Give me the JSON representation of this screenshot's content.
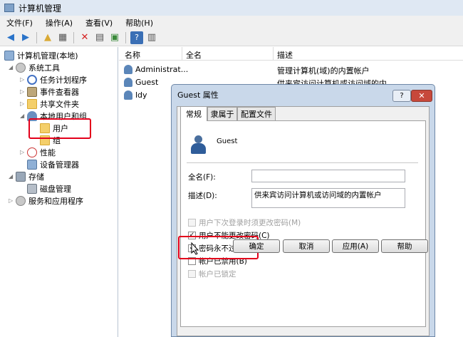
{
  "window": {
    "title": "计算机管理"
  },
  "menu": [
    "文件(F)",
    "操作(A)",
    "查看(V)",
    "帮助(H)"
  ],
  "tree": {
    "root": "计算机管理(本地)",
    "system_tools": "系统工具",
    "task_scheduler": "任务计划程序",
    "event_viewer": "事件查看器",
    "shared_folders": "共享文件夹",
    "local_users_groups": "本地用户和组",
    "users": "用户",
    "groups": "组",
    "performance": "性能",
    "device_manager": "设备管理器",
    "storage": "存储",
    "disk_management": "磁盘管理",
    "services_apps": "服务和应用程序"
  },
  "list": {
    "headers": [
      "名称",
      "全名",
      "描述"
    ],
    "rows": [
      {
        "name": "Administrat...",
        "fullname": "",
        "desc": "管理计算机(域)的内置帐户"
      },
      {
        "name": "Guest",
        "fullname": "",
        "desc": "供来宾访问计算机或访问域的内"
      },
      {
        "name": "ldy",
        "fullname": "",
        "desc": ""
      }
    ]
  },
  "dialog": {
    "title": "Guest 属性",
    "help": "?",
    "close": "✕",
    "tabs": [
      "常规",
      "隶属于",
      "配置文件"
    ],
    "username": "Guest",
    "fullname_label": "全名(F):",
    "fullname_value": "",
    "desc_label": "描述(D):",
    "desc_value": "供来宾访问计算机或访问域的内置帐户",
    "checkboxes": [
      {
        "label": "用户下次登录时须更改密码(M)",
        "checked": false,
        "enabled": false
      },
      {
        "label": "用户不能更改密码(C)",
        "checked": true,
        "enabled": true
      },
      {
        "label": "密码永不过期(P)",
        "checked": true,
        "enabled": true
      },
      {
        "label": "帐户已禁用(B)",
        "checked": false,
        "enabled": true
      },
      {
        "label": "帐户已锁定",
        "checked": false,
        "enabled": false
      }
    ],
    "buttons": [
      "确定",
      "取消",
      "应用(A)",
      "帮助"
    ]
  }
}
